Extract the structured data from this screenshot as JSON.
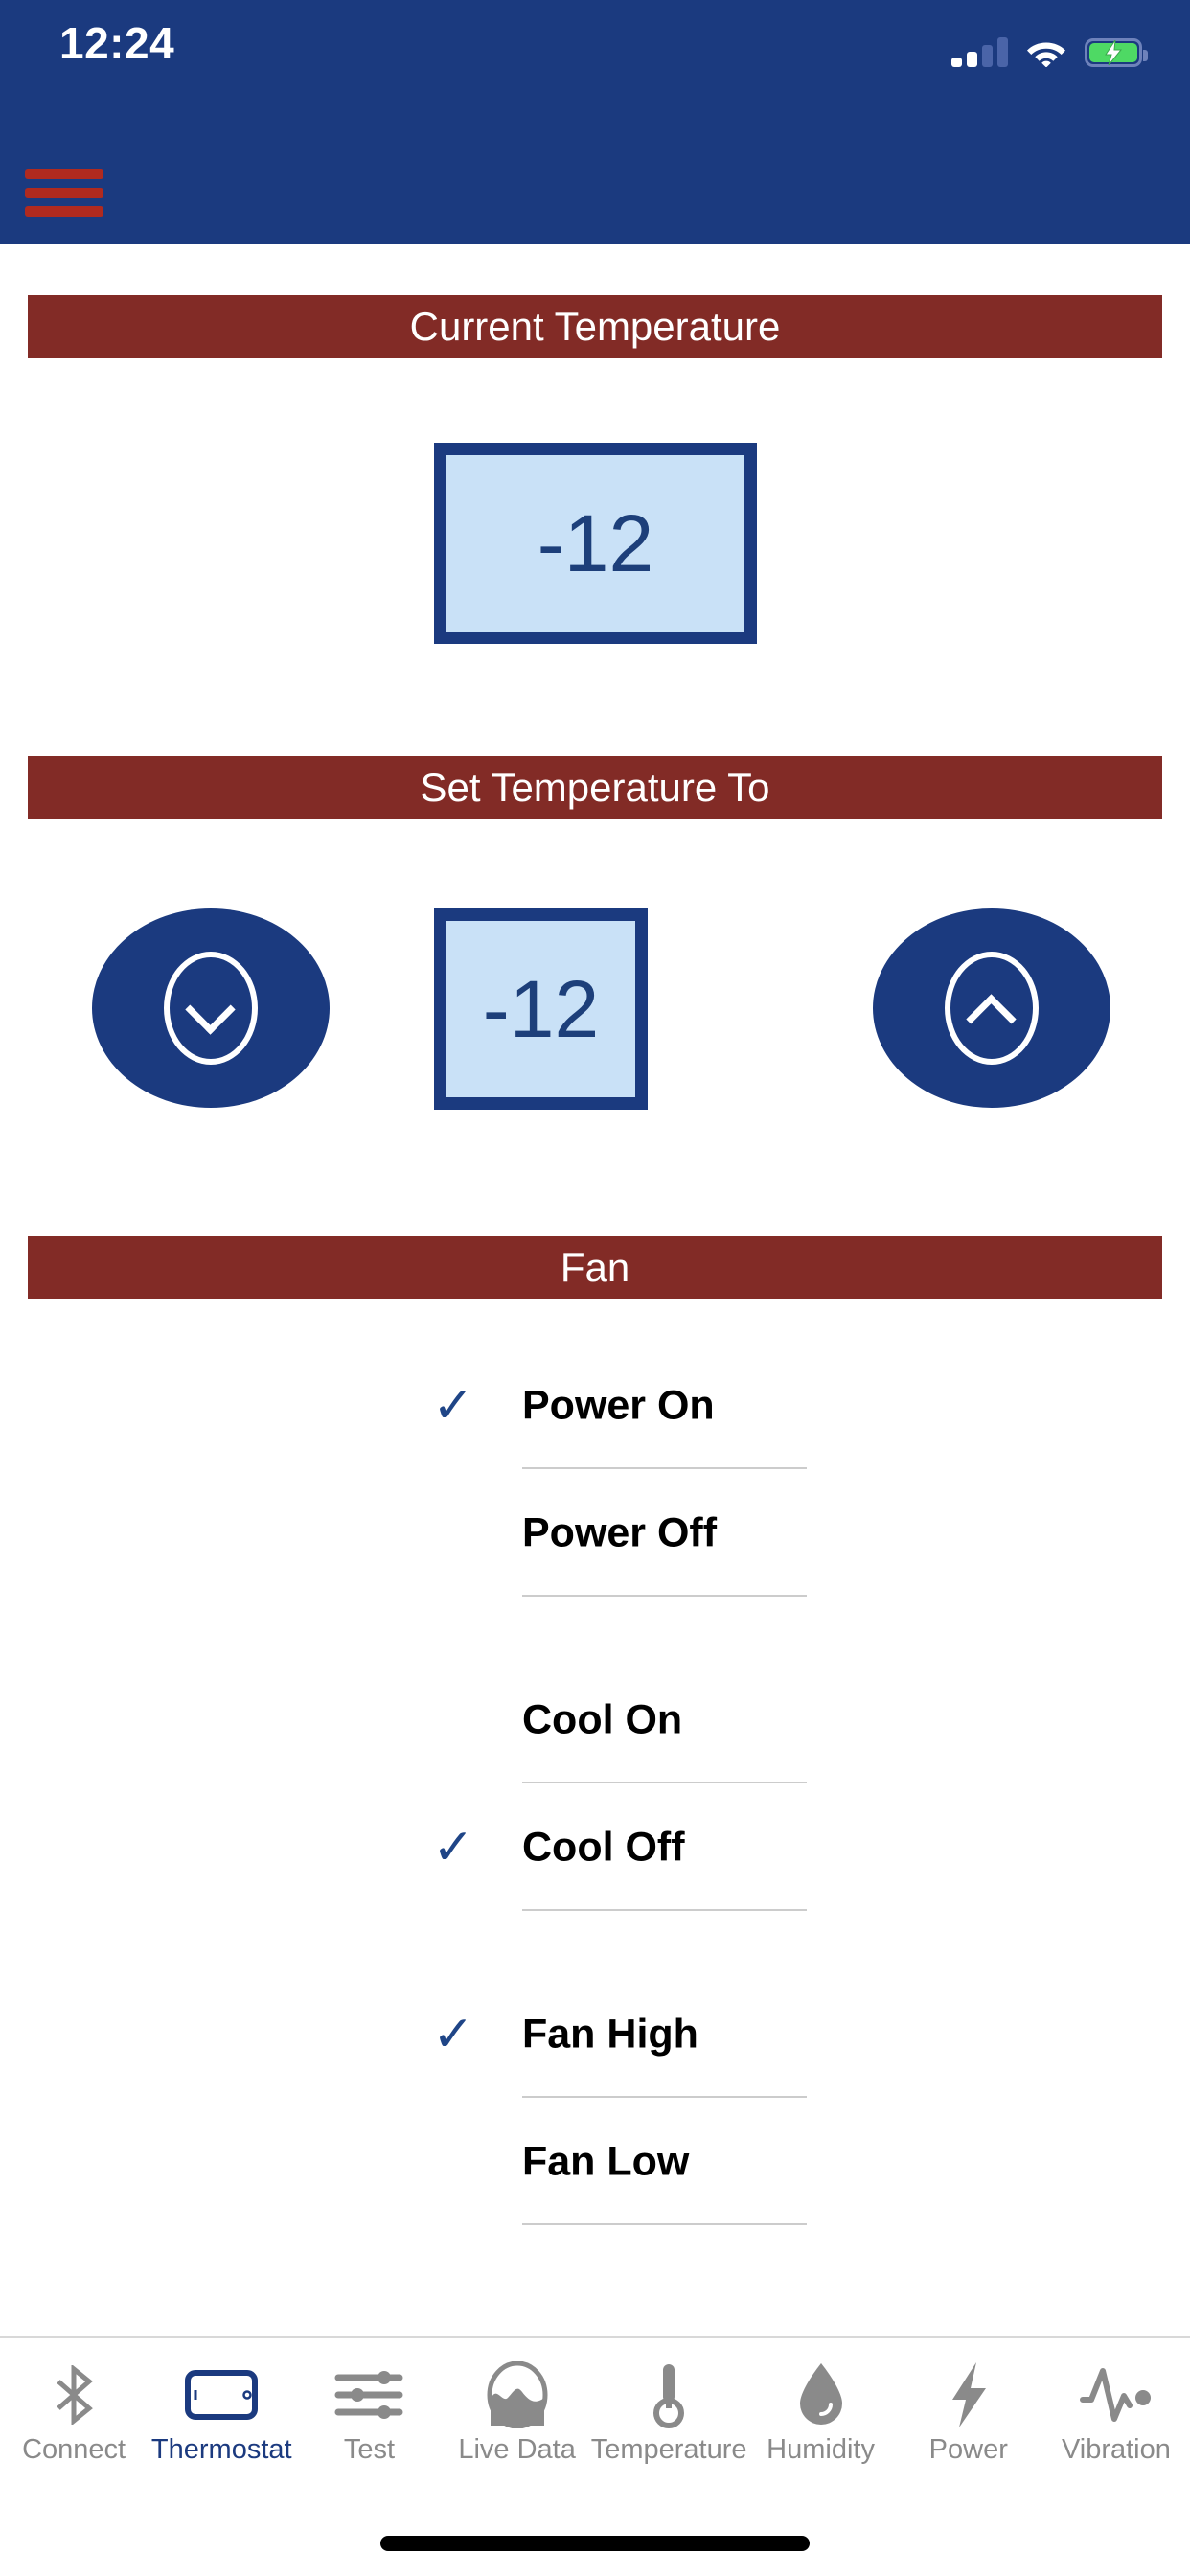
{
  "status_bar": {
    "time": "12:24",
    "signal_icon": "cellular-signal-icon",
    "wifi_icon": "wifi-icon",
    "battery_icon": "battery-charging-icon"
  },
  "navbar": {
    "menu_icon": "hamburger-menu-icon",
    "background_color": "#1b3a7f",
    "menu_color": "#b02a1f"
  },
  "sections": {
    "current_temperature": {
      "header": "Current Temperature",
      "value": "-12"
    },
    "set_temperature": {
      "header": "Set Temperature To",
      "value": "-12",
      "decrease_icon": "chevron-down-circle-icon",
      "increase_icon": "chevron-up-circle-icon"
    },
    "fan": {
      "header": "Fan",
      "options": [
        {
          "label": "Power On",
          "checked": true,
          "check_glyph": "✓"
        },
        {
          "label": "Power Off",
          "checked": false,
          "check_glyph": ""
        },
        {
          "label": "Cool On",
          "checked": false,
          "check_glyph": ""
        },
        {
          "label": "Cool Off",
          "checked": true,
          "check_glyph": "✓"
        },
        {
          "label": "Fan High",
          "checked": true,
          "check_glyph": "✓"
        },
        {
          "label": "Fan Low",
          "checked": false,
          "check_glyph": ""
        }
      ]
    }
  },
  "header_bar_color": "#822b26",
  "accent_color": "#1b3a7f",
  "tabbar": {
    "items": [
      {
        "label": "Connect",
        "icon": "bluetooth-icon",
        "active": false
      },
      {
        "label": "Thermostat",
        "icon": "tablet-icon",
        "active": true
      },
      {
        "label": "Test",
        "icon": "sliders-icon",
        "active": false
      },
      {
        "label": "Live Data",
        "icon": "waveform-oval-icon",
        "active": false
      },
      {
        "label": "Temperature",
        "icon": "thermometer-icon",
        "active": false
      },
      {
        "label": "Humidity",
        "icon": "water-drop-icon",
        "active": false
      },
      {
        "label": "Power",
        "icon": "lightning-bolt-icon",
        "active": false
      },
      {
        "label": "Vibration",
        "icon": "pulse-wave-icon",
        "active": false
      }
    ]
  }
}
